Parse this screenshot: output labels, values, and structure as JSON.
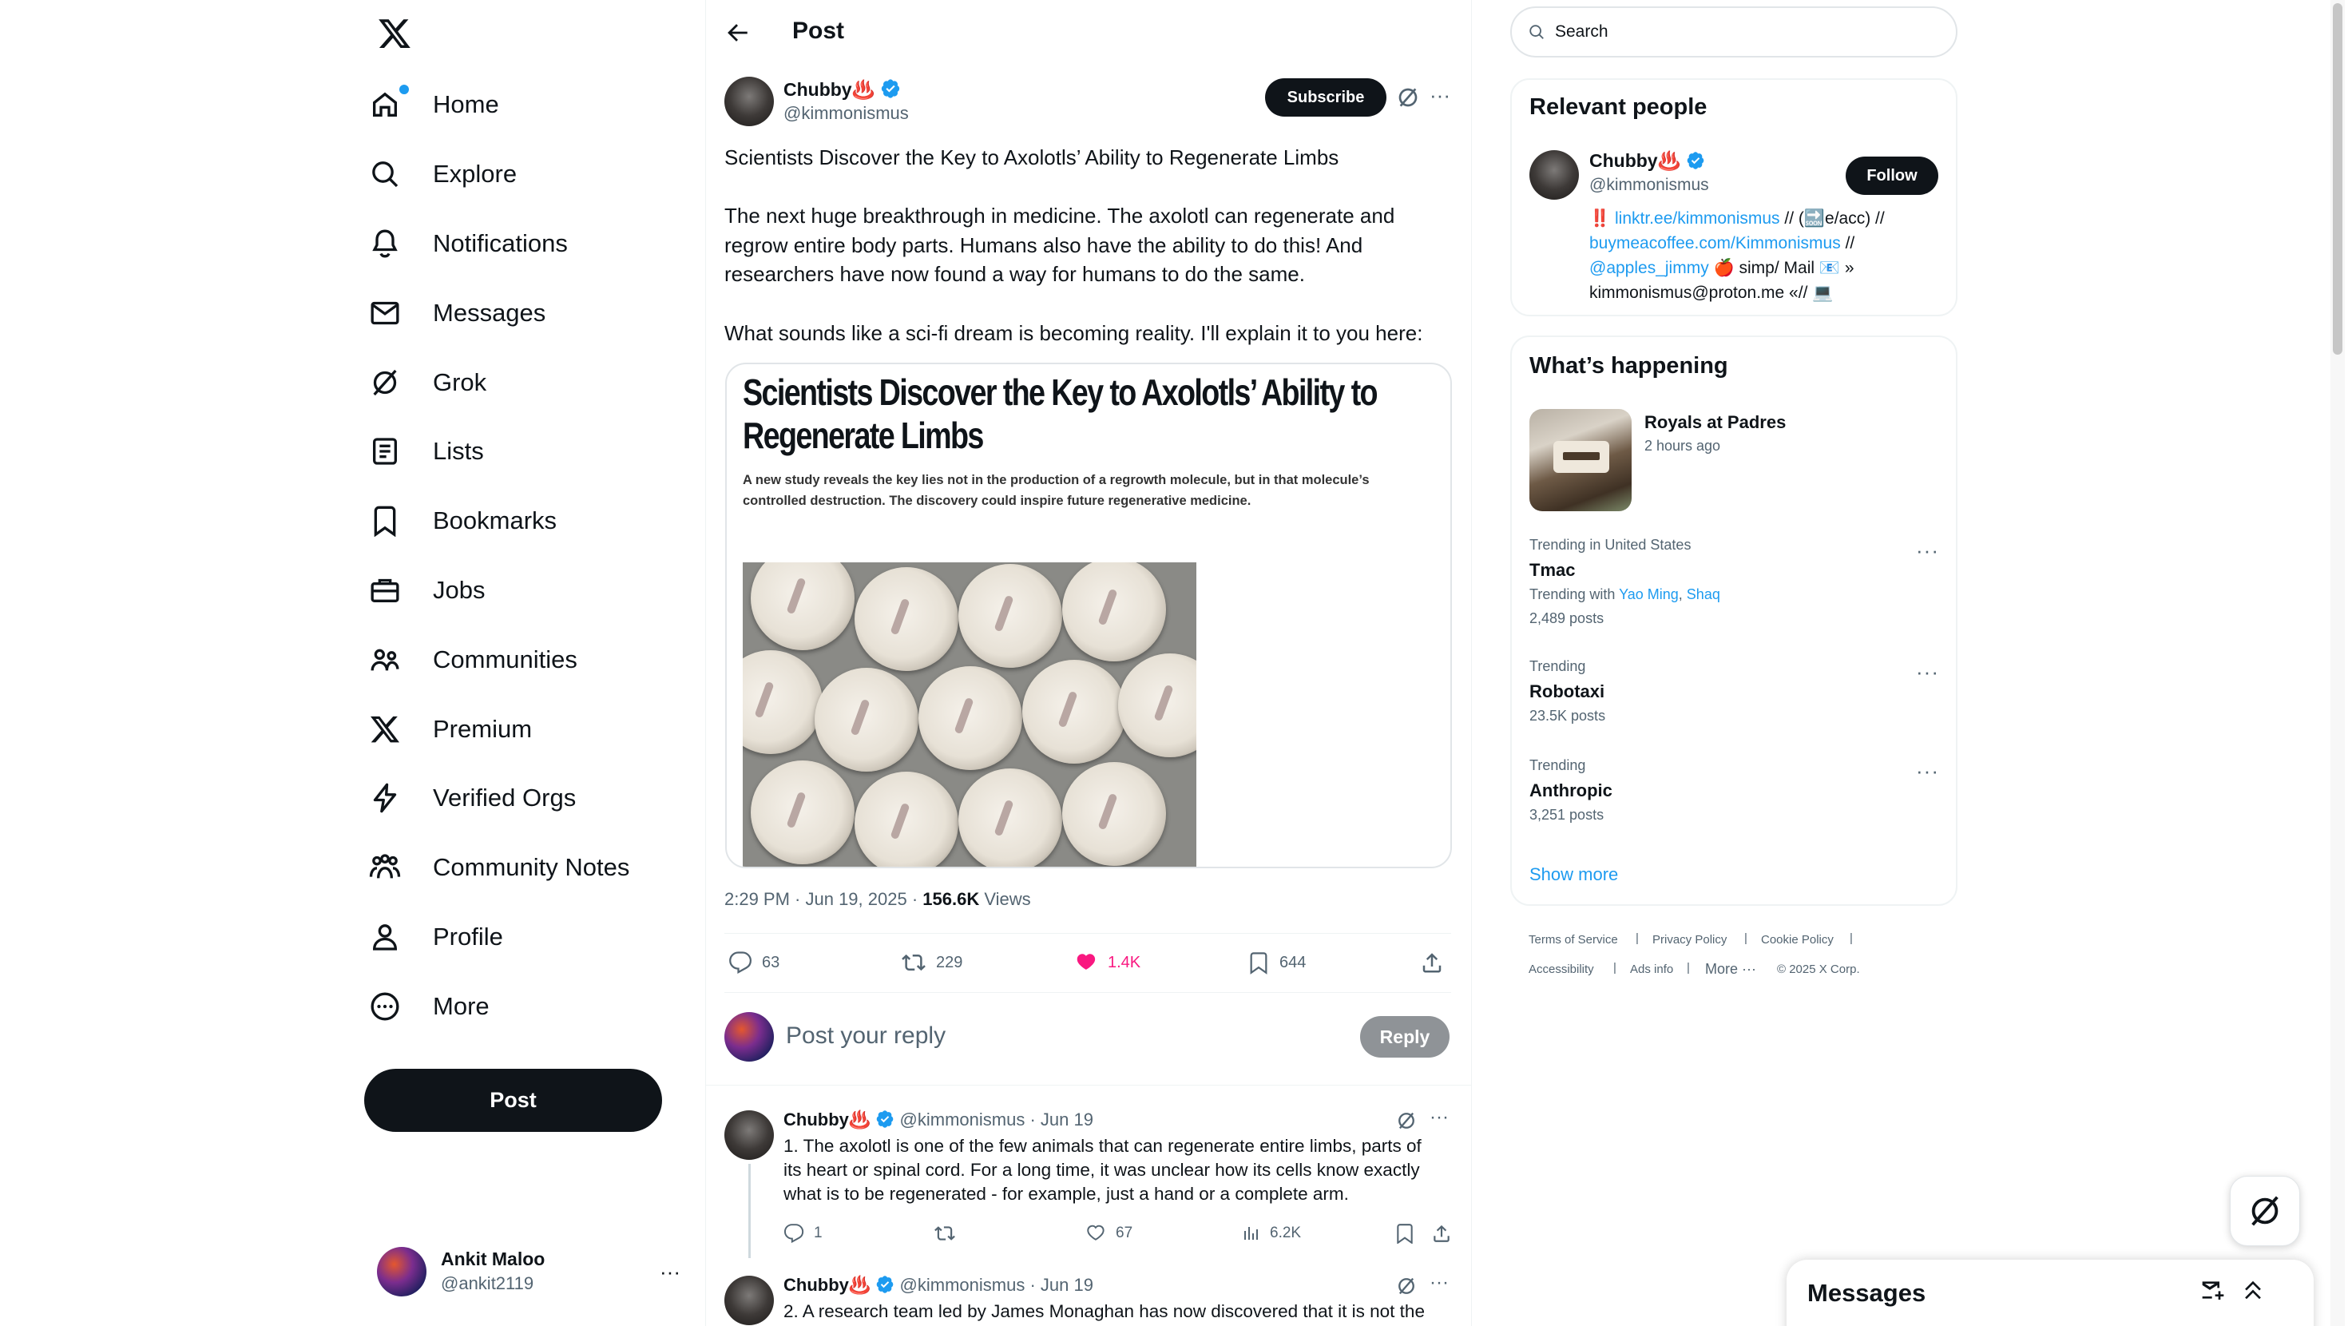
{
  "nav": {
    "items": [
      {
        "label": "Home",
        "icon": "home-icon"
      },
      {
        "label": "Explore",
        "icon": "search-icon"
      },
      {
        "label": "Notifications",
        "icon": "bell-icon"
      },
      {
        "label": "Messages",
        "icon": "mail-icon"
      },
      {
        "label": "Grok",
        "icon": "grok-icon"
      },
      {
        "label": "Lists",
        "icon": "list-icon"
      },
      {
        "label": "Bookmarks",
        "icon": "bookmark-icon"
      },
      {
        "label": "Jobs",
        "icon": "briefcase-icon"
      },
      {
        "label": "Communities",
        "icon": "communities-icon"
      },
      {
        "label": "Premium",
        "icon": "x-logo-icon"
      },
      {
        "label": "Verified Orgs",
        "icon": "lightning-icon"
      },
      {
        "label": "Community Notes",
        "icon": "community-notes-icon"
      },
      {
        "label": "Profile",
        "icon": "person-icon"
      },
      {
        "label": "More",
        "icon": "more-circle-icon"
      }
    ],
    "post_button": "Post",
    "account": {
      "name": "Ankit Maloo",
      "handle": "@ankit2119"
    }
  },
  "header": {
    "title": "Post"
  },
  "post": {
    "author_name": "Chubby♨️",
    "handle": "@kimmonismus",
    "subscribe_label": "Subscribe",
    "text_1": "Scientists Discover the Key to Axolotls’ Ability to Regenerate Limbs",
    "text_2a": "The next huge breakthrough in medicine. The axolotl can regenerate and",
    "text_2b": "regrow entire body parts. Humans also have the ability to do this! And",
    "text_2c": "researchers have now found a way for humans to do the same.",
    "text_3": "What sounds like a sci-fi dream is becoming reality. I'll explain it to you here:",
    "article_headline_1": "Scientists Discover the Key to Axolotls’ Ability to",
    "article_headline_2": "Regenerate Limbs",
    "article_sub_1": "A new study reveals the key lies not in the production of a regrowth molecule, but in that molecule’s",
    "article_sub_2": "controlled destruction. The discovery could inspire future regenerative medicine.",
    "timestamp": "2:29 PM · Jun 19, 2025 · ",
    "views_count": "156.6K",
    "views_label": " Views",
    "replies": "63",
    "reposts": "229",
    "likes": "1.4K",
    "bookmarks": "644",
    "like_color": "#f91880"
  },
  "reply_box": {
    "placeholder": "Post your reply",
    "button": "Reply"
  },
  "thread": [
    {
      "author_name": "Chubby♨️",
      "handle": "@kimmonismus",
      "date": "· Jun 19",
      "line1": "1. The axolotl is one of the few animals that can regenerate entire limbs, parts of",
      "line2": "its heart or spinal cord. For a long time, it was unclear how its cells know exactly",
      "line3": "what is to be regenerated - for example, just a hand or a complete arm.",
      "replies": "1",
      "likes": "67",
      "views": "6.2K"
    },
    {
      "author_name": "Chubby♨️",
      "handle": "@kimmonismus",
      "date": "· Jun 19",
      "line1": "2. A research team led by James Monaghan has now discovered that it is not the"
    }
  ],
  "search": {
    "placeholder": "Search"
  },
  "relevant": {
    "title": "Relevant people",
    "name": "Chubby♨️",
    "handle": "@kimmonismus",
    "follow": "Follow",
    "bio_link1": "linktr.ee/kimmonismus",
    "bio_text1": " // (🔜e/acc) //",
    "bio_link2": "buymeacoffee.com/Kimmonismus",
    "bio_text2": " //",
    "bio_link3": "@apples_jimmy",
    "bio_text3": " 🍎 simp/ Mail 📧 »",
    "bio_text4": "kimmonismus@proton.me «// 💻",
    "bio_mark": "‼️"
  },
  "happening": {
    "title": "What’s happening",
    "event_title": "Royals at Padres",
    "event_time": "2 hours ago",
    "trends": [
      {
        "context": "Trending in United States",
        "name": "Tmac",
        "with_label": "Trending with ",
        "with_1": "Yao Ming",
        "with_2": "Shaq",
        "posts": "2,489 posts"
      },
      {
        "context": "Trending",
        "name": "Robotaxi",
        "posts": "23.5K posts"
      },
      {
        "context": "Trending",
        "name": "Anthropic",
        "posts": "3,251 posts"
      }
    ],
    "show_more": "Show more"
  },
  "footer": {
    "tos": "Terms of Service",
    "privacy": "Privacy Policy",
    "cookie": "Cookie Policy",
    "accessibility": "Accessibility",
    "ads": "Ads info",
    "more": "More ···",
    "copyright": "© 2025 X Corp."
  },
  "messages_drawer": {
    "title": "Messages"
  }
}
